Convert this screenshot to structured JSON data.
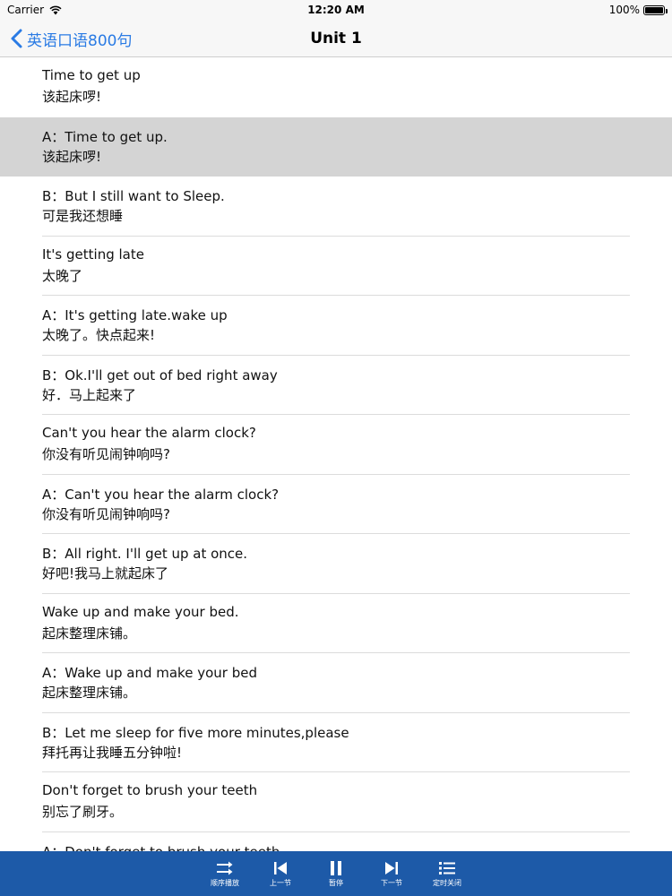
{
  "status": {
    "carrier": "Carrier",
    "time": "12:20 AM",
    "battery": "100%",
    "battery_level": 1.0
  },
  "nav": {
    "back_label": "英语口语800句",
    "title": "Unit 1"
  },
  "rows": [
    {
      "en": "Time to get up",
      "zh": "该起床啰!"
    },
    {
      "en": "A：Time to get up.",
      "zh": "该起床啰!"
    },
    {
      "en": "B：But I still want to Sleep.",
      "zh": "可是我还想睡"
    },
    {
      "en": "It's getting late",
      "zh": "太晚了"
    },
    {
      "en": "A：It's getting late.wake up",
      "zh": "太晚了。快点起来!"
    },
    {
      "en": "B：Ok.I'll get out of bed right away",
      "zh": "好．马上起来了"
    },
    {
      "en": "Can't you hear the alarm clock?",
      "zh": "你没有听见闹钟响吗?"
    },
    {
      "en": "A：Can't you hear the alarm clock?",
      "zh": "你没有听见闹钟响吗?"
    },
    {
      "en": "B：All right.  I'll get up at once.",
      "zh": "好吧!我马上就起床了"
    },
    {
      "en": "Wake up and make your bed.",
      "zh": "起床整理床铺。"
    },
    {
      "en": "A：Wake up and make your bed",
      "zh": "起床整理床铺。"
    },
    {
      "en": "B：Let me sleep for five more minutes,please",
      "zh": "拜托再让我睡五分钟啦!"
    },
    {
      "en": "Don't forget to brush your teeth",
      "zh": "别忘了刷牙。"
    },
    {
      "en": "A：Don't forget to brush your teeth",
      "zh": ""
    }
  ],
  "selected_row_index": 1,
  "toolbar": {
    "items": [
      {
        "label": "顺序播放",
        "icon": "shuffle-icon"
      },
      {
        "label": "上一节",
        "icon": "previous-icon"
      },
      {
        "label": "暂停",
        "icon": "pause-icon"
      },
      {
        "label": "下一节",
        "icon": "next-icon"
      },
      {
        "label": "定时关闭",
        "icon": "list-icon"
      }
    ]
  },
  "colors": {
    "accent": "#2a7be4",
    "toolbar_bg": "#1d5aa8",
    "selected_row": "#d4d4d4"
  }
}
